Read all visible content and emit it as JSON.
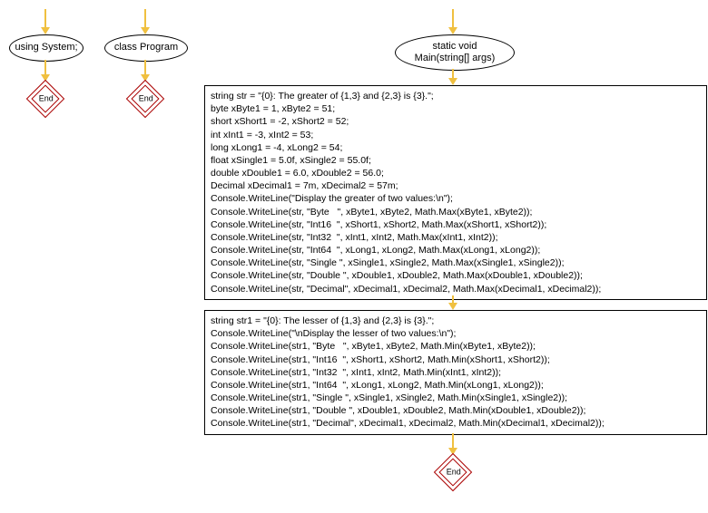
{
  "nodes": {
    "using_system": "using System;",
    "class_program": "class Program",
    "main": "static void\nMain(string[] args)",
    "end": "End"
  },
  "box1_lines": [
    "string str = \"{0}: The greater of {1,3} and {2,3} is {3}.\";",
    "byte xByte1 = 1, xByte2 = 51;",
    "short xShort1 = -2, xShort2 = 52;",
    "int xInt1 = -3, xInt2 = 53;",
    "long xLong1 = -4, xLong2 = 54;",
    "float xSingle1 = 5.0f, xSingle2 = 55.0f;",
    "double xDouble1 = 6.0, xDouble2 = 56.0;",
    "Decimal xDecimal1 = 7m, xDecimal2 = 57m;",
    "Console.WriteLine(\"Display the greater of two values:\\n\");",
    "Console.WriteLine(str, \"Byte   \", xByte1, xByte2, Math.Max(xByte1, xByte2));",
    "Console.WriteLine(str, \"Int16  \", xShort1, xShort2, Math.Max(xShort1, xShort2));",
    "Console.WriteLine(str, \"Int32  \", xInt1, xInt2, Math.Max(xInt1, xInt2));",
    "Console.WriteLine(str, \"Int64  \", xLong1, xLong2, Math.Max(xLong1, xLong2));",
    "Console.WriteLine(str, \"Single \", xSingle1, xSingle2, Math.Max(xSingle1, xSingle2));",
    "Console.WriteLine(str, \"Double \", xDouble1, xDouble2, Math.Max(xDouble1, xDouble2));",
    "Console.WriteLine(str, \"Decimal\", xDecimal1, xDecimal2, Math.Max(xDecimal1, xDecimal2));"
  ],
  "box2_lines": [
    "string str1 = \"{0}: The lesser of {1,3} and {2,3} is {3}.\";",
    "Console.WriteLine(\"\\nDisplay the lesser of two values:\\n\");",
    "Console.WriteLine(str1, \"Byte   \", xByte1, xByte2, Math.Min(xByte1, xByte2));",
    "Console.WriteLine(str1, \"Int16  \", xShort1, xShort2, Math.Min(xShort1, xShort2));",
    "Console.WriteLine(str1, \"Int32  \", xInt1, xInt2, Math.Min(xInt1, xInt2));",
    "Console.WriteLine(str1, \"Int64  \", xLong1, xLong2, Math.Min(xLong1, xLong2));",
    "Console.WriteLine(str1, \"Single \", xSingle1, xSingle2, Math.Min(xSingle1, xSingle2));",
    "Console.WriteLine(str1, \"Double \", xDouble1, xDouble2, Math.Min(xDouble1, xDouble2));",
    "Console.WriteLine(str1, \"Decimal\", xDecimal1, xDecimal2, Math.Min(xDecimal1, xDecimal2));"
  ]
}
